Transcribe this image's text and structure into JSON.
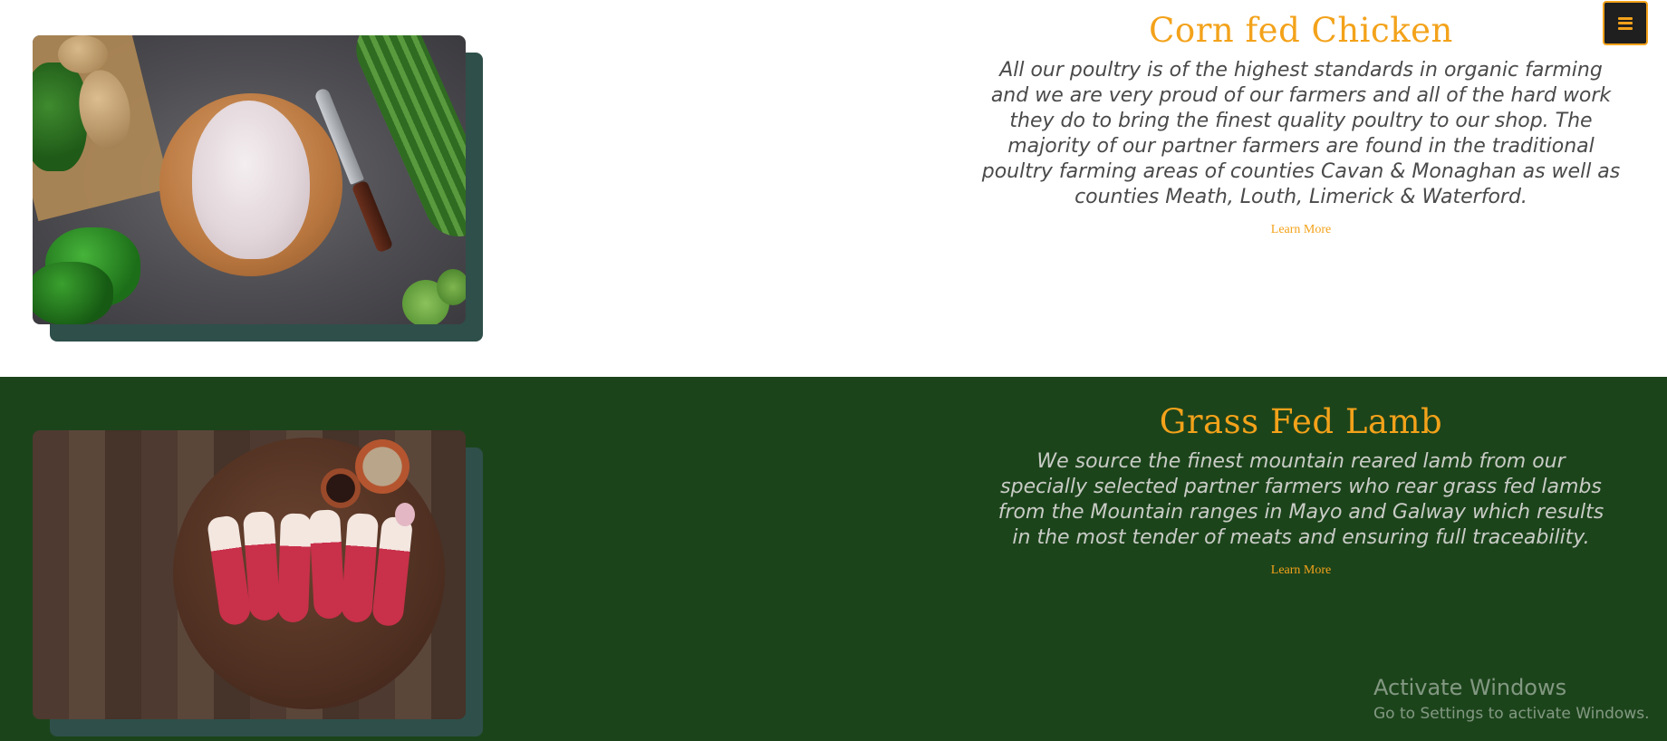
{
  "nav": {
    "menu_icon": "hamburger-menu-icon",
    "accent_color": "#f3a21a"
  },
  "sections": [
    {
      "title": "Corn fed Chicken",
      "description": "All our poultry is of the highest standards in organic farming and we are very proud of our farmers and all of the hard work they do to bring the finest quality poultry to our shop. The majority of our partner farmers are found in the traditional poultry farming areas of counties Cavan & Monaghan as well as counties Meath, Louth, Limerick & Waterford.",
      "link_label": "Learn More",
      "background": "#ffffff"
    },
    {
      "title": "Grass Fed Lamb",
      "description": "We source the finest mountain reared lamb from our specially selected partner farmers who rear grass fed lambs from the Mountain ranges in Mayo and Galway which results in the most tender of meats and ensuring full traceability.",
      "link_label": "Learn More",
      "background": "#1c441b"
    }
  ],
  "watermark": {
    "title": "Activate Windows",
    "subtitle": "Go to Settings to activate Windows."
  }
}
